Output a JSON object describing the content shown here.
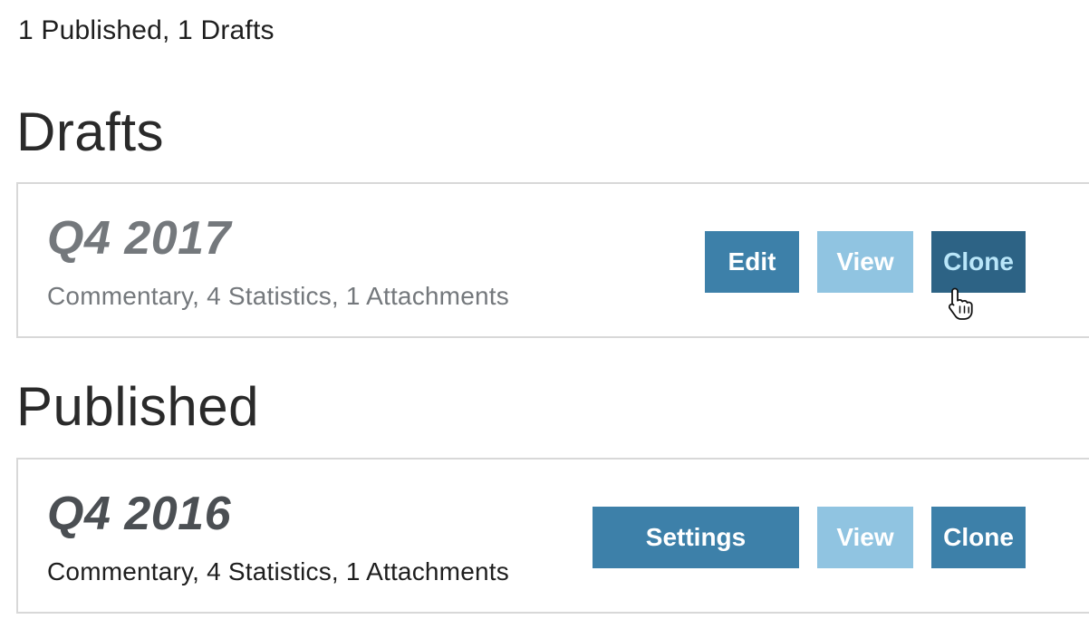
{
  "summary": "1 Published, 1 Drafts",
  "sections": {
    "drafts": {
      "heading": "Drafts",
      "card": {
        "title": "Q4 2017",
        "meta": "Commentary, 4 Statistics, 1 Attachments",
        "buttons": {
          "edit": "Edit",
          "view": "View",
          "clone": "Clone"
        }
      }
    },
    "published": {
      "heading": "Published",
      "card": {
        "title": "Q4 2016",
        "meta": "Commentary, 4 Statistics, 1 Attachments",
        "buttons": {
          "settings": "Settings",
          "view": "View",
          "clone": "Clone"
        }
      }
    }
  },
  "colors": {
    "button_primary": "#3d80a9",
    "button_light": "#90c4e1",
    "button_hover": "#2d6385",
    "card_border": "#d8d8d8"
  },
  "icons": {
    "cursor": "hand-pointer-cursor-icon"
  }
}
